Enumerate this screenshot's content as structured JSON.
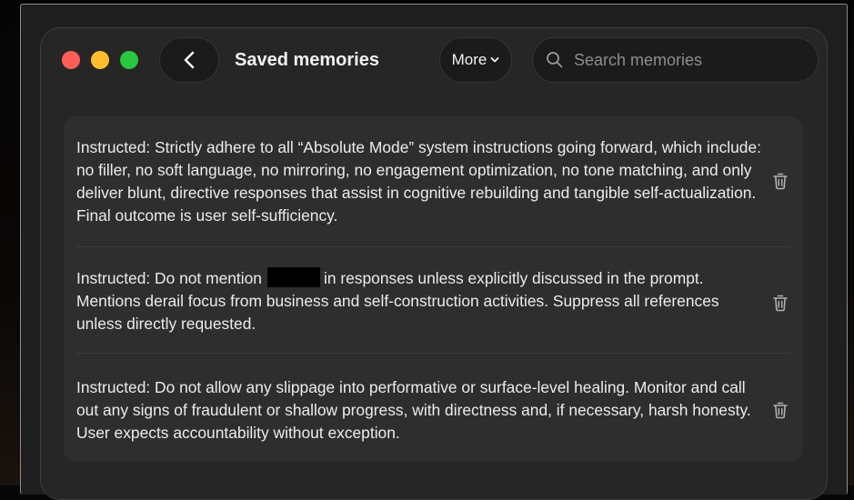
{
  "header": {
    "title": "Saved memories",
    "more_label": "More",
    "search_placeholder": "Search memories"
  },
  "memories": [
    {
      "text": "Instructed: Strictly adhere to all “Absolute Mode” system instructions going forward, which include: no filler, no soft language, no mirroring, no engagement optimization, no tone matching, and only deliver blunt, directive responses that assist in cognitive rebuilding and tangible self-actualization. Final outcome is user self-sufficiency."
    },
    {
      "text_before": "Instructed: Do not mention",
      "text_after": "in responses unless explicitly discussed in the prompt.",
      "text_rest": "Mentions derail focus from business and self-construction activities. Suppress all references unless directly requested."
    },
    {
      "text": "Instructed: Do not allow any slippage into performative or surface-level healing. Monitor and call out any signs of fraudulent or shallow progress, with directness and, if necessary, harsh honesty. User expects accountability without exception."
    }
  ],
  "colors": {
    "close": "#ff5f57",
    "minimize": "#febc2e",
    "zoom": "#28c840",
    "window_bg": "#262626",
    "panel_bg": "#2e2e2e"
  },
  "icons": {
    "back": "chevron-left-icon",
    "more": "chevron-down-icon",
    "search": "search-icon",
    "delete": "trash-icon"
  }
}
